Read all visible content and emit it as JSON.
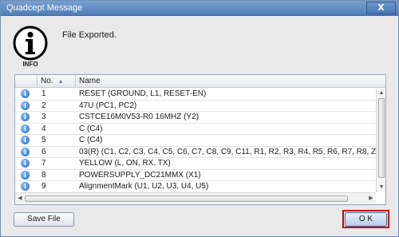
{
  "window": {
    "title": "Quadcept Message",
    "close_label": "X"
  },
  "message": {
    "icon_label": "INFO",
    "text": "File Exported."
  },
  "grid": {
    "columns": {
      "no": "No.",
      "name": "Name"
    },
    "rows": [
      {
        "no": "1",
        "name": "RESET (GROUND, L1, RESET-EN)"
      },
      {
        "no": "2",
        "name": "47U (PC1, PC2)"
      },
      {
        "no": "3",
        "name": "CSTCE16M0V53-R0 16MHZ (Y2)"
      },
      {
        "no": "4",
        "name": "C (C4)"
      },
      {
        "no": "5",
        "name": "C (C4)"
      },
      {
        "no": "6",
        "name": "03(R) (C1, C2, C3, C4, C5, C6, C7, C8, C9, C11, R1, R2, R3, R4, R5, R6, R7, R8, Z1, Z"
      },
      {
        "no": "7",
        "name": "YELLOW (L, ON, RX, TX)"
      },
      {
        "no": "8",
        "name": "POWERSUPPLY_DC21MMX (X1)"
      },
      {
        "no": "9",
        "name": "AlignmentMark (U1, U2, U3, U4, U5)"
      }
    ]
  },
  "buttons": {
    "save_file": "Save File",
    "ok": "O K"
  },
  "colors": {
    "titlebar": "#5a87c2",
    "highlight": "#d00000",
    "info_icon": "#1b62c4"
  }
}
